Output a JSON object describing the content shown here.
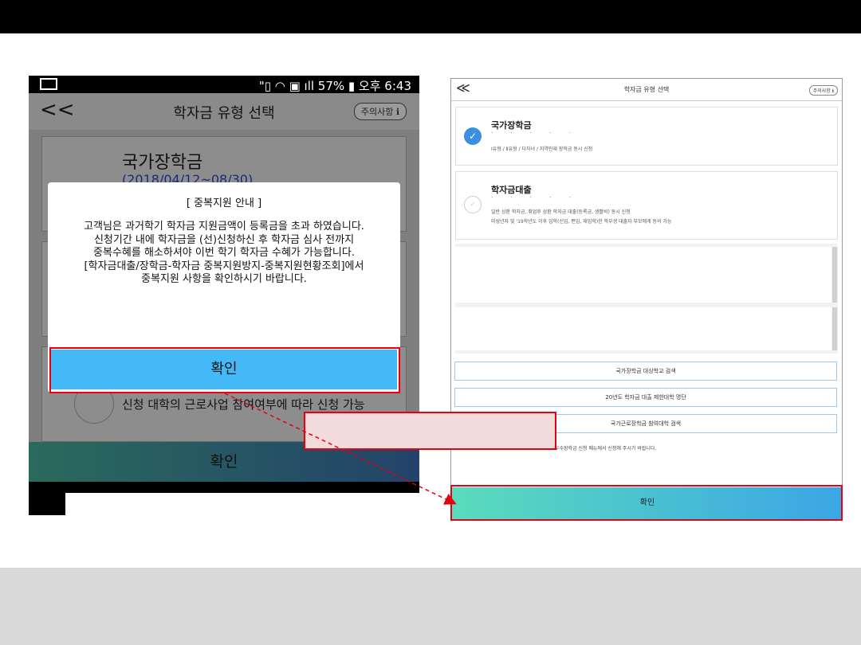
{
  "left_phone": {
    "status_bar": {
      "right_text": "\"▯ ◠ ▣ ıll 57% ▮ 오후 6:43",
      "battery": "57%",
      "time": "오후 6:43"
    },
    "header": {
      "back": "<<",
      "title": "학자금 유형 선택",
      "caution": "주의사항 ℹ"
    },
    "bg_card1": {
      "title": "국가장학금",
      "date": "(2018/04/12~08/30)"
    },
    "bg_card3": {
      "text": "신청 대학의 근로사업 참여여부에 따라 신청 가능"
    },
    "confirm_label": "확인",
    "modal": {
      "title": "[ 중복지원 안내 ]",
      "lines": [
        "고객님은 과거학기 학자금 지원금액이 등록금을 초과 하였습니다.",
        "신청기간 내에 학자금을 (선)신청하신 후 학자금 심사 전까지",
        "중복수혜를 해소하셔야 이번 학기 학자금 수혜가 가능합니다.",
        "[학자금대출/장학금-학자금 중복지원방지-중복지원현황조회]에서",
        "중복지원 사항을 확인하시기 바랍니다."
      ],
      "button": "확인"
    }
  },
  "right_web": {
    "header": {
      "back": "≪",
      "title": "학자금 유형 선택",
      "caution": "주의사항 ℹ"
    },
    "card1": {
      "title": "국가장학금",
      "dots": "· · · · ·",
      "desc": "Ⅰ유형 / Ⅱ유형 / 다자녀 / 지역인재 장학금 동시 신청"
    },
    "card2": {
      "title": "학자금대출",
      "dots": "· · · · ·",
      "desc1": "일반 상환 학자금, 취업후 상환 학자금 대출(등록금, 생활비) 동시 신청",
      "desc2": "미성년자 및 '19학년도 이후 입학(신입, 편입, 재입학)한 학부생 대출자 부모에게 동의 가능"
    },
    "links": [
      "국가장학금 대상학교 검색",
      "20년도 학자금 대출 제한대학 명단",
      "국가근로장학금 참여대학 검색"
    ],
    "note": "우수장학금 신청 메뉴에서 신청해 주시기 바랍니다.",
    "confirm": "확인"
  },
  "callout": {
    "text": ""
  },
  "colors": {
    "highlight": "#e60012",
    "accent_blue": "#45b8f8",
    "callout_fill": "#f2dcdb"
  }
}
